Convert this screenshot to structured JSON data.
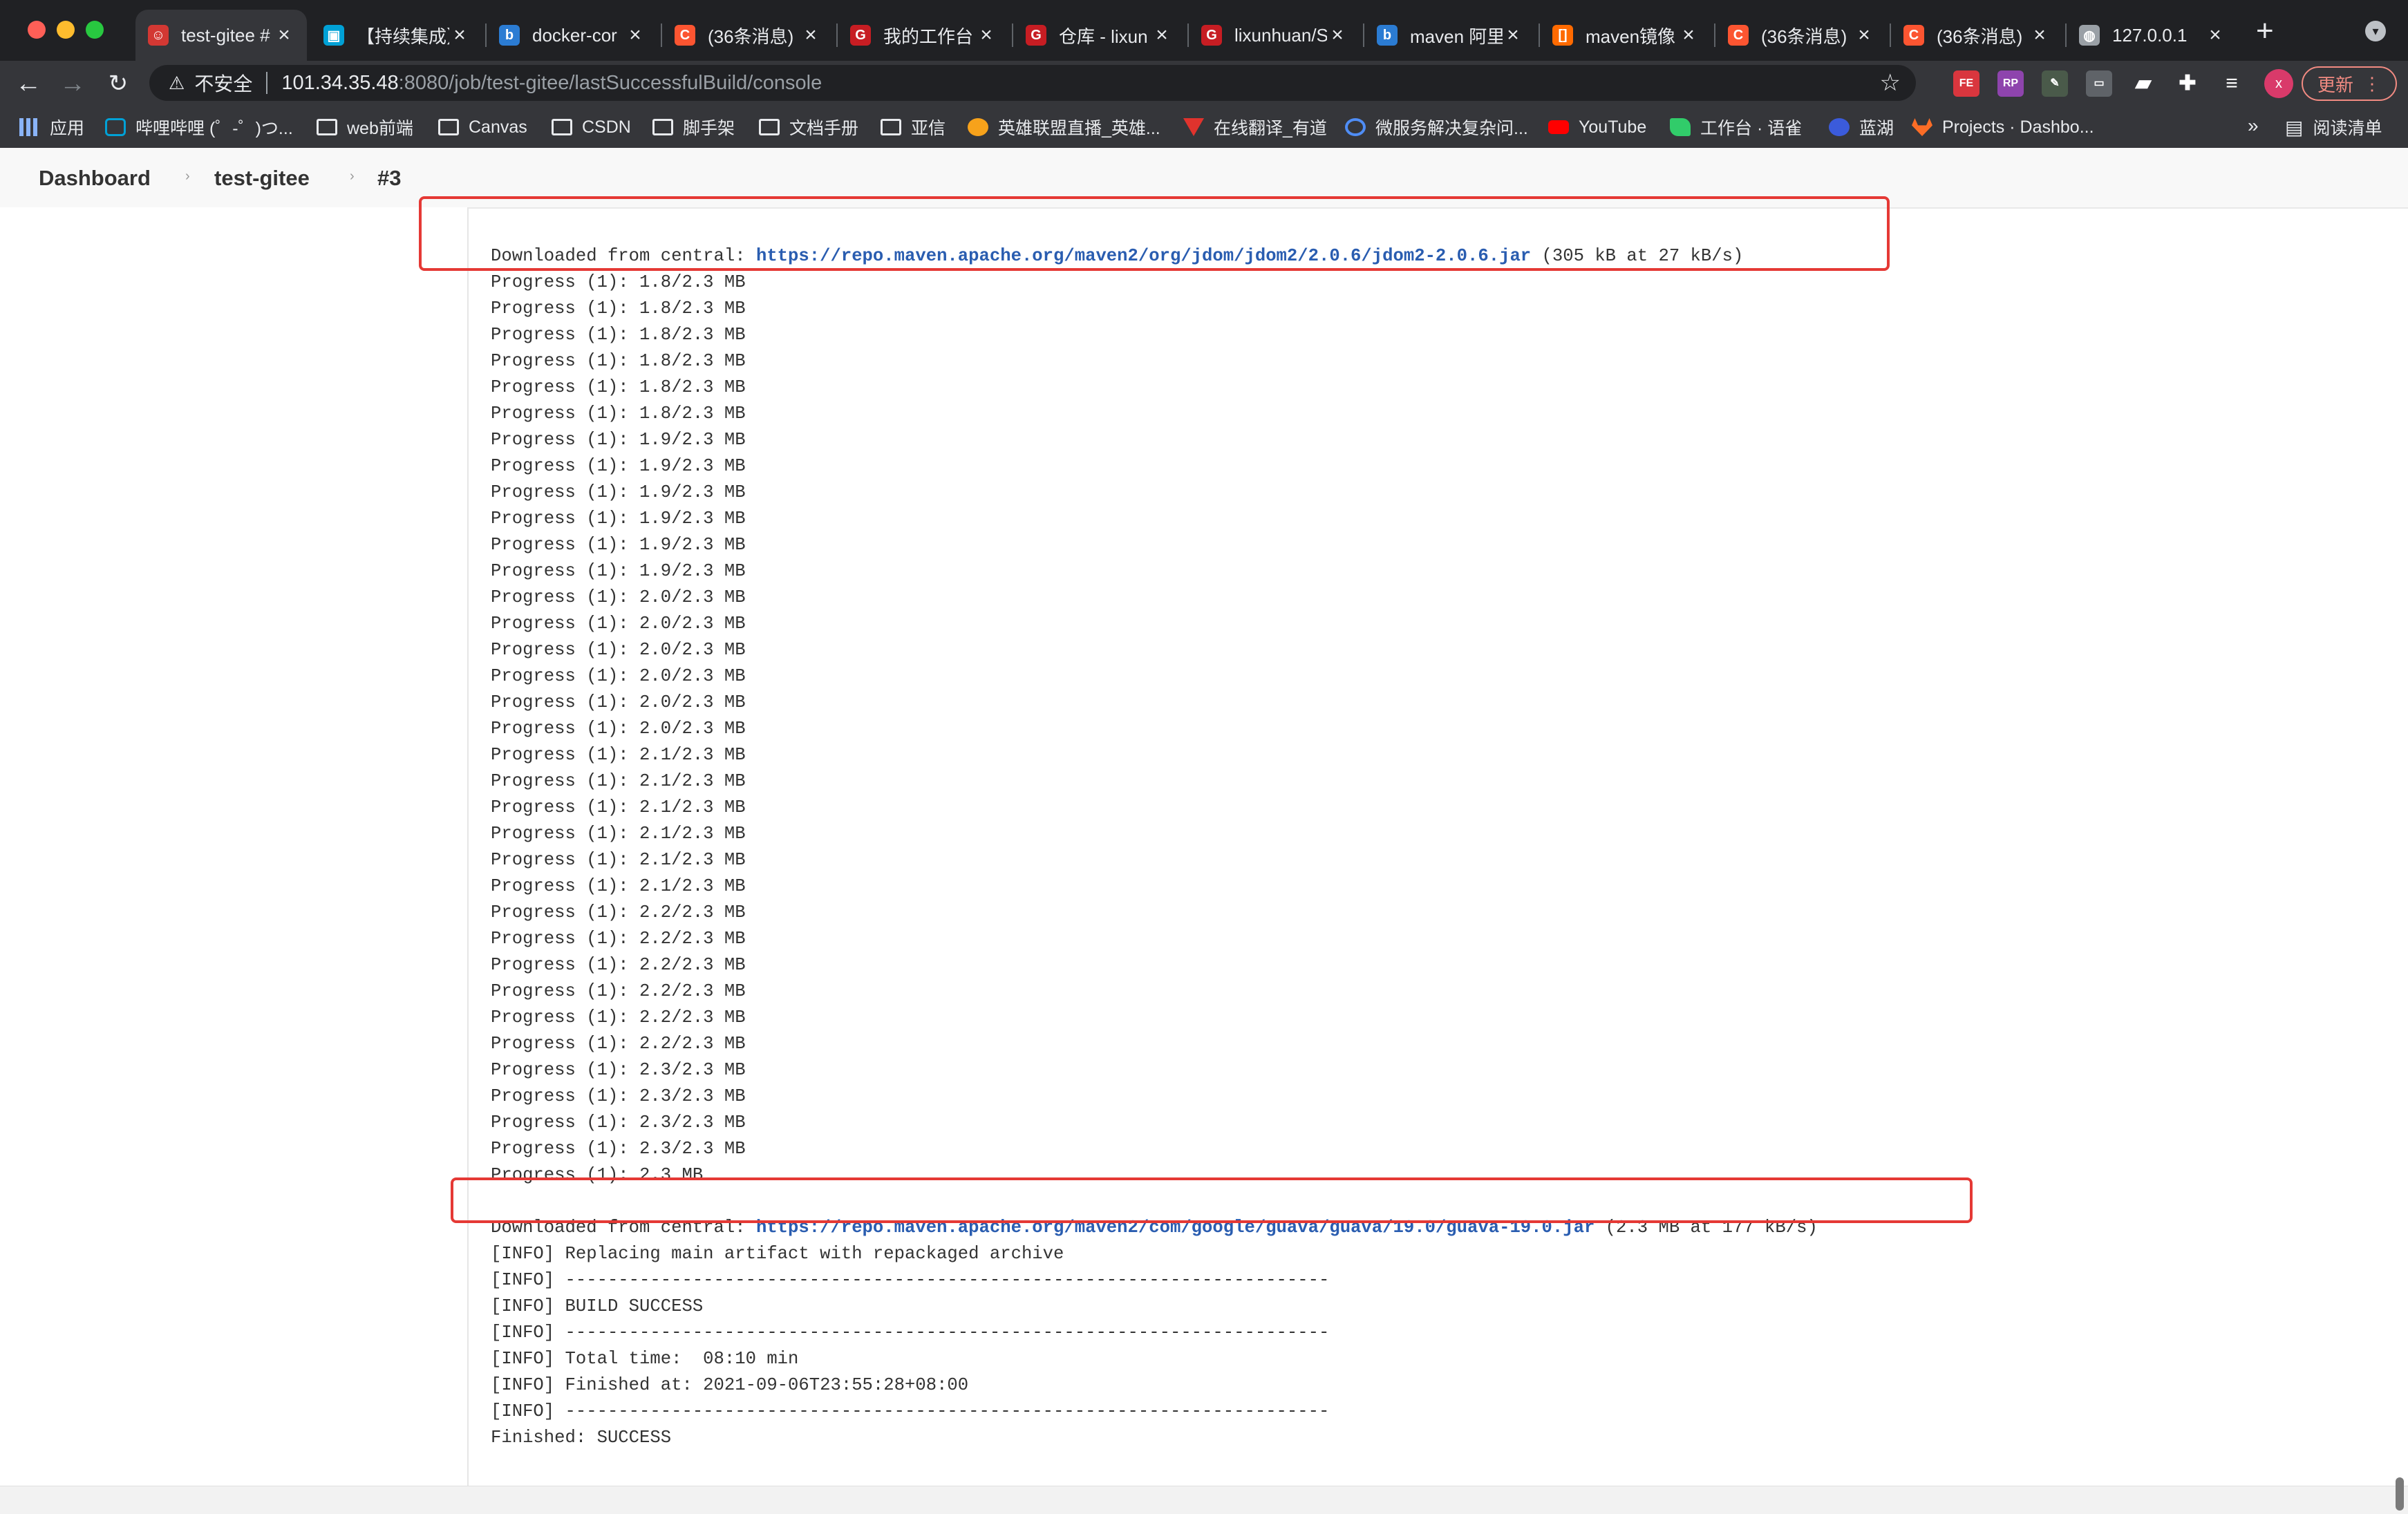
{
  "browser": {
    "tabs": [
      {
        "title": "test-gitee #",
        "icon": "jenkins-icon",
        "color": "#d33833",
        "active": true
      },
      {
        "title": "【持续集成】",
        "icon": "bilibili-icon",
        "color": "#00a1d6"
      },
      {
        "title": "docker-cor",
        "icon": "bing-icon",
        "color": "#2b7cd3"
      },
      {
        "title": "(36条消息)",
        "icon": "csdn-icon",
        "color": "#fc5531"
      },
      {
        "title": "我的工作台",
        "icon": "gitee-icon",
        "color": "#c71d23"
      },
      {
        "title": "仓库 - lixun",
        "icon": "gitee-icon",
        "color": "#c71d23"
      },
      {
        "title": "lixunhuan/S",
        "icon": "gitee-icon",
        "color": "#c71d23"
      },
      {
        "title": "maven 阿里",
        "icon": "bing-icon",
        "color": "#2b7cd3"
      },
      {
        "title": "maven镜像",
        "icon": "aliyun-icon",
        "color": "#ff6a00"
      },
      {
        "title": "(36条消息)",
        "icon": "csdn-icon",
        "color": "#fc5531"
      },
      {
        "title": "(36条消息)",
        "icon": "csdn-icon",
        "color": "#fc5531"
      },
      {
        "title": "127.0.0.1",
        "icon": "globe-icon",
        "color": "#9aa0a6"
      }
    ],
    "address": {
      "security_label": "不安全",
      "host": "101.34.35.48",
      "path": ":8080/job/test-gitee/lastSuccessfulBuild/console"
    },
    "update_label": "更新",
    "avatar_letter": "x",
    "reading_list_label": "阅读清单",
    "bookmarks": [
      {
        "label": "应用",
        "icon": "apps-grid-icon"
      },
      {
        "label": "哔哩哔哩 (゜-゜)つ...",
        "icon": "bilibili-icon"
      },
      {
        "label": "web前端",
        "icon": "folder-icon"
      },
      {
        "label": "Canvas",
        "icon": "folder-icon"
      },
      {
        "label": "CSDN",
        "icon": "folder-icon"
      },
      {
        "label": "脚手架",
        "icon": "folder-icon"
      },
      {
        "label": "文档手册",
        "icon": "folder-icon"
      },
      {
        "label": "亚信",
        "icon": "folder-icon"
      },
      {
        "label": "英雄联盟直播_英雄...",
        "icon": "douyu-icon"
      },
      {
        "label": "在线翻译_有道",
        "icon": "youdao-icon"
      },
      {
        "label": "微服务解决复杂问...",
        "icon": "search-globe-icon"
      },
      {
        "label": "YouTube",
        "icon": "youtube-icon"
      },
      {
        "label": "工作台 · 语雀",
        "icon": "yuque-icon"
      },
      {
        "label": "蓝湖",
        "icon": "lanhu-icon"
      },
      {
        "label": "Projects · Dashbo...",
        "icon": "gitlab-icon"
      }
    ]
  },
  "breadcrumb": {
    "items": [
      "Dashboard",
      "test-gitee",
      "#3"
    ]
  },
  "console": {
    "download1": {
      "prefix": "Downloaded from central: ",
      "url": "https://repo.maven.apache.org/maven2/org/jdom/jdom2/2.0.6/jdom2-2.0.6.jar",
      "suffix": " (305 kB at 27 kB/s)"
    },
    "progress_lines": [
      "Progress (1): 1.8/2.3 MB",
      "Progress (1): 1.8/2.3 MB",
      "Progress (1): 1.8/2.3 MB",
      "Progress (1): 1.8/2.3 MB",
      "Progress (1): 1.8/2.3 MB",
      "Progress (1): 1.8/2.3 MB",
      "Progress (1): 1.9/2.3 MB",
      "Progress (1): 1.9/2.3 MB",
      "Progress (1): 1.9/2.3 MB",
      "Progress (1): 1.9/2.3 MB",
      "Progress (1): 1.9/2.3 MB",
      "Progress (1): 1.9/2.3 MB",
      "Progress (1): 2.0/2.3 MB",
      "Progress (1): 2.0/2.3 MB",
      "Progress (1): 2.0/2.3 MB",
      "Progress (1): 2.0/2.3 MB",
      "Progress (1): 2.0/2.3 MB",
      "Progress (1): 2.0/2.3 MB",
      "Progress (1): 2.1/2.3 MB",
      "Progress (1): 2.1/2.3 MB",
      "Progress (1): 2.1/2.3 MB",
      "Progress (1): 2.1/2.3 MB",
      "Progress (1): 2.1/2.3 MB",
      "Progress (1): 2.1/2.3 MB",
      "Progress (1): 2.2/2.3 MB",
      "Progress (1): 2.2/2.3 MB",
      "Progress (1): 2.2/2.3 MB",
      "Progress (1): 2.2/2.3 MB",
      "Progress (1): 2.2/2.3 MB",
      "Progress (1): 2.2/2.3 MB",
      "Progress (1): 2.3/2.3 MB",
      "Progress (1): 2.3/2.3 MB",
      "Progress (1): 2.3/2.3 MB",
      "Progress (1): 2.3/2.3 MB",
      "Progress (1): 2.3 MB"
    ],
    "download2": {
      "prefix": "Downloaded from central: ",
      "url": "https://repo.maven.apache.org/maven2/com/google/guava/guava/19.0/guava-19.0.jar",
      "suffix": " (2.3 MB at 177 kB/s)"
    },
    "tail_lines": [
      "[INFO] Replacing main artifact with repackaged archive",
      "[INFO] ------------------------------------------------------------------------",
      "[INFO] BUILD SUCCESS",
      "[INFO] ------------------------------------------------------------------------",
      "[INFO] Total time:  08:10 min",
      "[INFO] Finished at: 2021-09-06T23:55:28+08:00",
      "[INFO] ------------------------------------------------------------------------",
      "Finished: SUCCESS"
    ]
  },
  "colors": {
    "highlight_box": "#e53935",
    "link": "#2a5db0"
  }
}
